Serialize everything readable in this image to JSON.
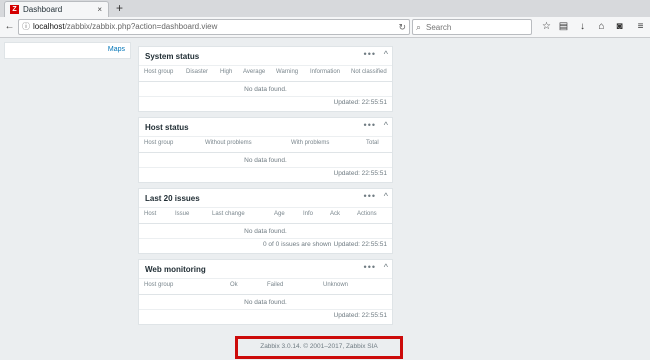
{
  "browser": {
    "tab_title": "Dashboard",
    "tab_close": "×",
    "new_tab": "+",
    "favicon_letter": "Z",
    "url_host": "localhost",
    "url_path": "/zabbix/zabbix.php?action=dashboard.view",
    "search_placeholder": "Search",
    "icons": [
      "back-icon",
      "info-icon",
      "reload-icon",
      "search-icon",
      "star-icon",
      "clipboard-icon",
      "download-icon",
      "home-icon",
      "pocket-icon",
      "hamburger-menu-icon"
    ]
  },
  "sidebar": {
    "link": "Maps"
  },
  "widgets": [
    {
      "title": "System status",
      "columns": [
        "Host group",
        "Disaster",
        "High",
        "Average",
        "Warning",
        "Information",
        "Not classified"
      ],
      "no_data": "No data found.",
      "updated": "Updated: 22:55:51"
    },
    {
      "title": "Host status",
      "columns": [
        "Host group",
        "Without problems",
        "With problems",
        "Total"
      ],
      "no_data": "No data found.",
      "updated": "Updated: 22:55:51"
    },
    {
      "title": "Last 20 issues",
      "columns": [
        "Host",
        "Issue",
        "Last change",
        "Age",
        "Info",
        "Ack",
        "Actions"
      ],
      "no_data": "No data found.",
      "count": "0 of 0 issues are shown",
      "updated": "Updated: 22:55:51"
    },
    {
      "title": "Web monitoring",
      "columns": [
        "Host group",
        "Ok",
        "Failed",
        "Unknown"
      ],
      "no_data": "No data found.",
      "updated": "Updated: 22:55:51"
    }
  ],
  "widget_menu": "•••",
  "widget_collapse": "^",
  "footer": {
    "text": "Zabbix 3.0.14. © 2001–2017, Zabbix SIA",
    "highlight_color": "#cc0a0a"
  }
}
